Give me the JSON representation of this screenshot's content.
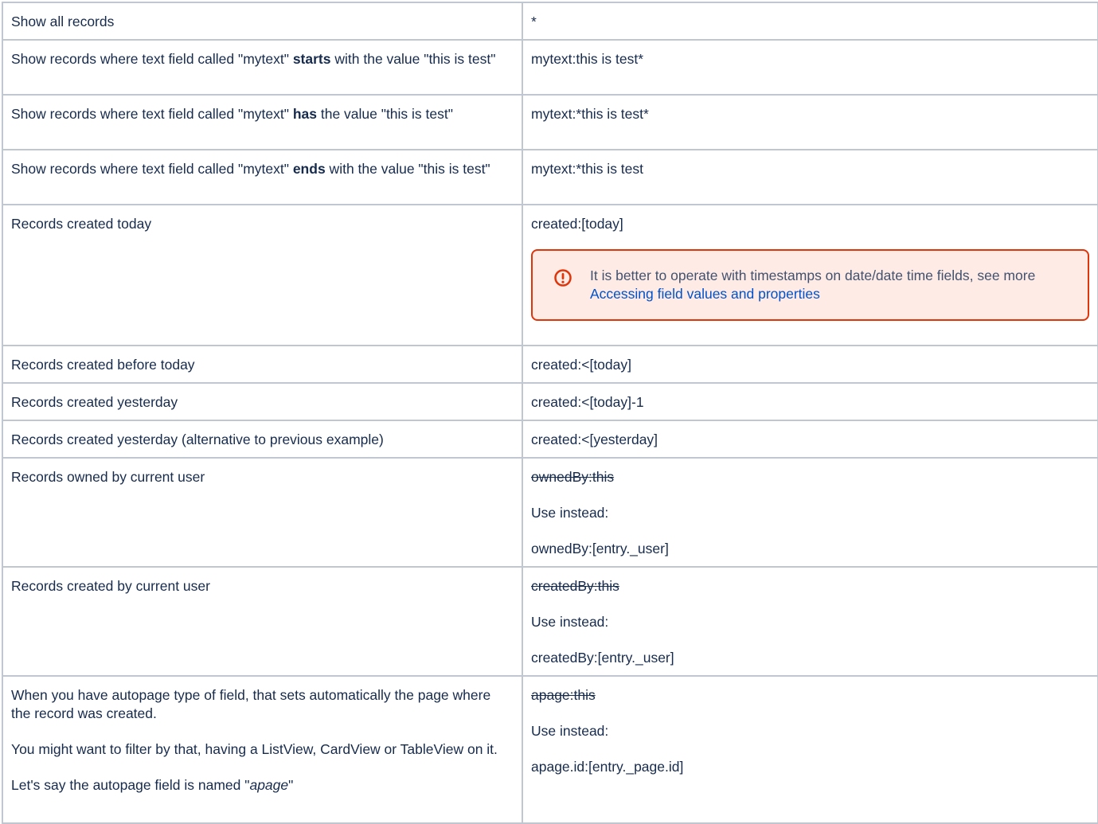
{
  "rows": [
    {
      "left": [
        "Show all records"
      ],
      "right": [
        "*"
      ]
    },
    {
      "left": [
        "Show records where text field called \"mytext\" ",
        "starts",
        " with the value \"this is test\""
      ],
      "right": [
        "mytext:this is test*"
      ]
    },
    {
      "left": [
        "Show records where text field called \"mytext\" ",
        "has",
        " the value \"this is test\""
      ],
      "right": [
        "mytext:*this is test*"
      ]
    },
    {
      "left": [
        "Show records where text field called \"mytext\" ",
        "ends",
        " with the value \"this is test\""
      ],
      "right": [
        "mytext:*this is test"
      ]
    },
    {
      "left": [
        "Records created today"
      ],
      "right": [
        "created:[today]"
      ],
      "panel": {
        "icon": "error-circle-icon",
        "text": "It is better to operate with timestamps on date/date time fields, see more ",
        "link": "Accessing field values and properties"
      }
    },
    {
      "left": [
        "Records created before today"
      ],
      "right": [
        "created:<[today]"
      ]
    },
    {
      "left": [
        "Records created yesterday"
      ],
      "right": [
        "created:<[today]-1"
      ]
    },
    {
      "left": [
        "Records created yesterday (alternative to previous example)"
      ],
      "right": [
        "created:<[yesterday]"
      ]
    },
    {
      "left": [
        "Records owned by current user"
      ],
      "right": [
        "ownedBy:this",
        "Use instead:",
        "ownedBy:[entry._user]"
      ]
    },
    {
      "left": [
        "Records created by current user"
      ],
      "right": [
        "createdBy:this",
        "Use instead:",
        "createdBy:[entry._user]"
      ]
    },
    {
      "left": [
        "When you have autopage type of field, that sets automatically the page where the record was created.",
        "You might want to filter by that, having a ListView, CardView or TableView on it.",
        "Let's say the autopage field is named \"",
        "apage",
        "\""
      ],
      "right": [
        "apage:this",
        "Use instead:",
        "apage.id:[entry._page.id]"
      ]
    }
  ],
  "colors": {
    "border": "#c1c7d0",
    "text": "#172b4d",
    "panel_border": "#de350b",
    "panel_bg": "#ffebe6",
    "link": "#0052cc"
  }
}
